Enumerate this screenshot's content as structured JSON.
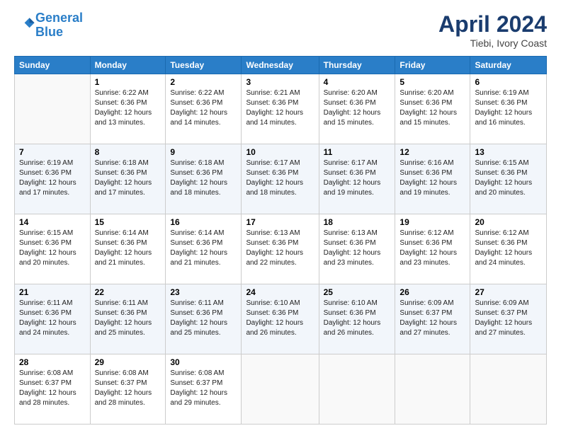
{
  "header": {
    "logo_line1": "General",
    "logo_line2": "Blue",
    "title": "April 2024",
    "subtitle": "Tiebi, Ivory Coast"
  },
  "days_of_week": [
    "Sunday",
    "Monday",
    "Tuesday",
    "Wednesday",
    "Thursday",
    "Friday",
    "Saturday"
  ],
  "weeks": [
    [
      {
        "day": "",
        "sunrise": "",
        "sunset": "",
        "daylight": ""
      },
      {
        "day": "1",
        "sunrise": "Sunrise: 6:22 AM",
        "sunset": "Sunset: 6:36 PM",
        "daylight": "Daylight: 12 hours and 13 minutes."
      },
      {
        "day": "2",
        "sunrise": "Sunrise: 6:22 AM",
        "sunset": "Sunset: 6:36 PM",
        "daylight": "Daylight: 12 hours and 14 minutes."
      },
      {
        "day": "3",
        "sunrise": "Sunrise: 6:21 AM",
        "sunset": "Sunset: 6:36 PM",
        "daylight": "Daylight: 12 hours and 14 minutes."
      },
      {
        "day": "4",
        "sunrise": "Sunrise: 6:20 AM",
        "sunset": "Sunset: 6:36 PM",
        "daylight": "Daylight: 12 hours and 15 minutes."
      },
      {
        "day": "5",
        "sunrise": "Sunrise: 6:20 AM",
        "sunset": "Sunset: 6:36 PM",
        "daylight": "Daylight: 12 hours and 15 minutes."
      },
      {
        "day": "6",
        "sunrise": "Sunrise: 6:19 AM",
        "sunset": "Sunset: 6:36 PM",
        "daylight": "Daylight: 12 hours and 16 minutes."
      }
    ],
    [
      {
        "day": "7",
        "sunrise": "Sunrise: 6:19 AM",
        "sunset": "Sunset: 6:36 PM",
        "daylight": "Daylight: 12 hours and 17 minutes."
      },
      {
        "day": "8",
        "sunrise": "Sunrise: 6:18 AM",
        "sunset": "Sunset: 6:36 PM",
        "daylight": "Daylight: 12 hours and 17 minutes."
      },
      {
        "day": "9",
        "sunrise": "Sunrise: 6:18 AM",
        "sunset": "Sunset: 6:36 PM",
        "daylight": "Daylight: 12 hours and 18 minutes."
      },
      {
        "day": "10",
        "sunrise": "Sunrise: 6:17 AM",
        "sunset": "Sunset: 6:36 PM",
        "daylight": "Daylight: 12 hours and 18 minutes."
      },
      {
        "day": "11",
        "sunrise": "Sunrise: 6:17 AM",
        "sunset": "Sunset: 6:36 PM",
        "daylight": "Daylight: 12 hours and 19 minutes."
      },
      {
        "day": "12",
        "sunrise": "Sunrise: 6:16 AM",
        "sunset": "Sunset: 6:36 PM",
        "daylight": "Daylight: 12 hours and 19 minutes."
      },
      {
        "day": "13",
        "sunrise": "Sunrise: 6:15 AM",
        "sunset": "Sunset: 6:36 PM",
        "daylight": "Daylight: 12 hours and 20 minutes."
      }
    ],
    [
      {
        "day": "14",
        "sunrise": "Sunrise: 6:15 AM",
        "sunset": "Sunset: 6:36 PM",
        "daylight": "Daylight: 12 hours and 20 minutes."
      },
      {
        "day": "15",
        "sunrise": "Sunrise: 6:14 AM",
        "sunset": "Sunset: 6:36 PM",
        "daylight": "Daylight: 12 hours and 21 minutes."
      },
      {
        "day": "16",
        "sunrise": "Sunrise: 6:14 AM",
        "sunset": "Sunset: 6:36 PM",
        "daylight": "Daylight: 12 hours and 21 minutes."
      },
      {
        "day": "17",
        "sunrise": "Sunrise: 6:13 AM",
        "sunset": "Sunset: 6:36 PM",
        "daylight": "Daylight: 12 hours and 22 minutes."
      },
      {
        "day": "18",
        "sunrise": "Sunrise: 6:13 AM",
        "sunset": "Sunset: 6:36 PM",
        "daylight": "Daylight: 12 hours and 23 minutes."
      },
      {
        "day": "19",
        "sunrise": "Sunrise: 6:12 AM",
        "sunset": "Sunset: 6:36 PM",
        "daylight": "Daylight: 12 hours and 23 minutes."
      },
      {
        "day": "20",
        "sunrise": "Sunrise: 6:12 AM",
        "sunset": "Sunset: 6:36 PM",
        "daylight": "Daylight: 12 hours and 24 minutes."
      }
    ],
    [
      {
        "day": "21",
        "sunrise": "Sunrise: 6:11 AM",
        "sunset": "Sunset: 6:36 PM",
        "daylight": "Daylight: 12 hours and 24 minutes."
      },
      {
        "day": "22",
        "sunrise": "Sunrise: 6:11 AM",
        "sunset": "Sunset: 6:36 PM",
        "daylight": "Daylight: 12 hours and 25 minutes."
      },
      {
        "day": "23",
        "sunrise": "Sunrise: 6:11 AM",
        "sunset": "Sunset: 6:36 PM",
        "daylight": "Daylight: 12 hours and 25 minutes."
      },
      {
        "day": "24",
        "sunrise": "Sunrise: 6:10 AM",
        "sunset": "Sunset: 6:36 PM",
        "daylight": "Daylight: 12 hours and 26 minutes."
      },
      {
        "day": "25",
        "sunrise": "Sunrise: 6:10 AM",
        "sunset": "Sunset: 6:36 PM",
        "daylight": "Daylight: 12 hours and 26 minutes."
      },
      {
        "day": "26",
        "sunrise": "Sunrise: 6:09 AM",
        "sunset": "Sunset: 6:37 PM",
        "daylight": "Daylight: 12 hours and 27 minutes."
      },
      {
        "day": "27",
        "sunrise": "Sunrise: 6:09 AM",
        "sunset": "Sunset: 6:37 PM",
        "daylight": "Daylight: 12 hours and 27 minutes."
      }
    ],
    [
      {
        "day": "28",
        "sunrise": "Sunrise: 6:08 AM",
        "sunset": "Sunset: 6:37 PM",
        "daylight": "Daylight: 12 hours and 28 minutes."
      },
      {
        "day": "29",
        "sunrise": "Sunrise: 6:08 AM",
        "sunset": "Sunset: 6:37 PM",
        "daylight": "Daylight: 12 hours and 28 minutes."
      },
      {
        "day": "30",
        "sunrise": "Sunrise: 6:08 AM",
        "sunset": "Sunset: 6:37 PM",
        "daylight": "Daylight: 12 hours and 29 minutes."
      },
      {
        "day": "",
        "sunrise": "",
        "sunset": "",
        "daylight": ""
      },
      {
        "day": "",
        "sunrise": "",
        "sunset": "",
        "daylight": ""
      },
      {
        "day": "",
        "sunrise": "",
        "sunset": "",
        "daylight": ""
      },
      {
        "day": "",
        "sunrise": "",
        "sunset": "",
        "daylight": ""
      }
    ]
  ]
}
